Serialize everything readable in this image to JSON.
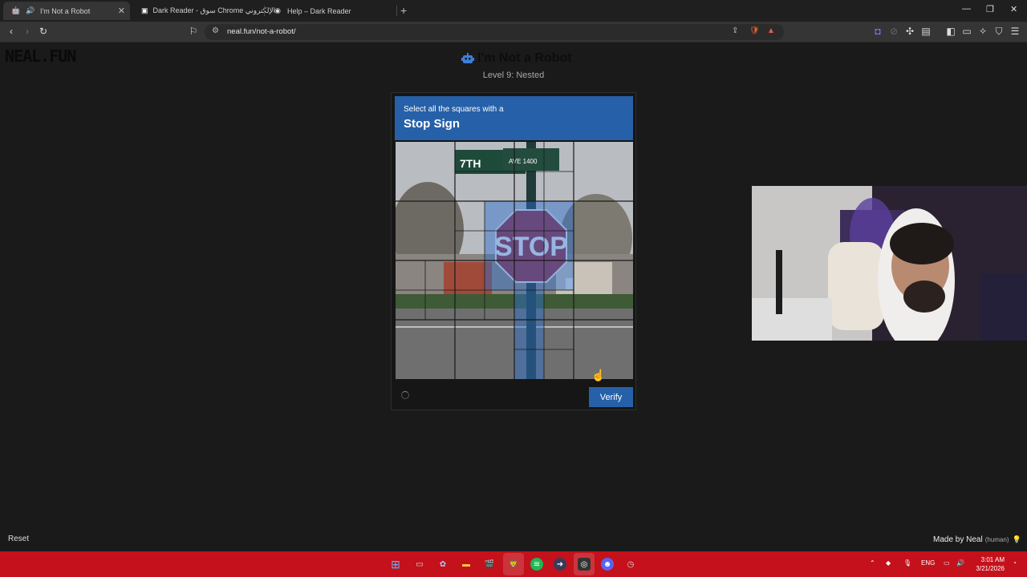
{
  "browser": {
    "tabs": [
      {
        "title": "I'm Not a Robot",
        "active": true
      },
      {
        "title": "Dark Reader - سوق Chrome الإلكتروني",
        "active": false
      },
      {
        "title": "Help – Dark Reader",
        "active": false
      }
    ],
    "url": "neal.fun/not-a-robot/"
  },
  "page": {
    "logo": "NEAL.FUN",
    "title": "I'm Not a Robot",
    "subtitle": "Level 9: Nested",
    "captcha": {
      "instruction": "Select all the squares with a",
      "target": "Stop Sign",
      "sign_text": "STOP",
      "street_sign_1": "7TH",
      "street_sign_2": "AVE 1400",
      "verify_label": "Verify"
    },
    "reset_label": "Reset",
    "made_by": "Made by Neal",
    "made_by_suffix": "(human)"
  },
  "taskbar": {
    "lang": "ENG",
    "time": "3:01 AM",
    "date": "3/21/2026"
  },
  "colors": {
    "accent": "#2660a8",
    "taskbar": "#c4111b",
    "selected_tile": "#2a6fd1"
  }
}
